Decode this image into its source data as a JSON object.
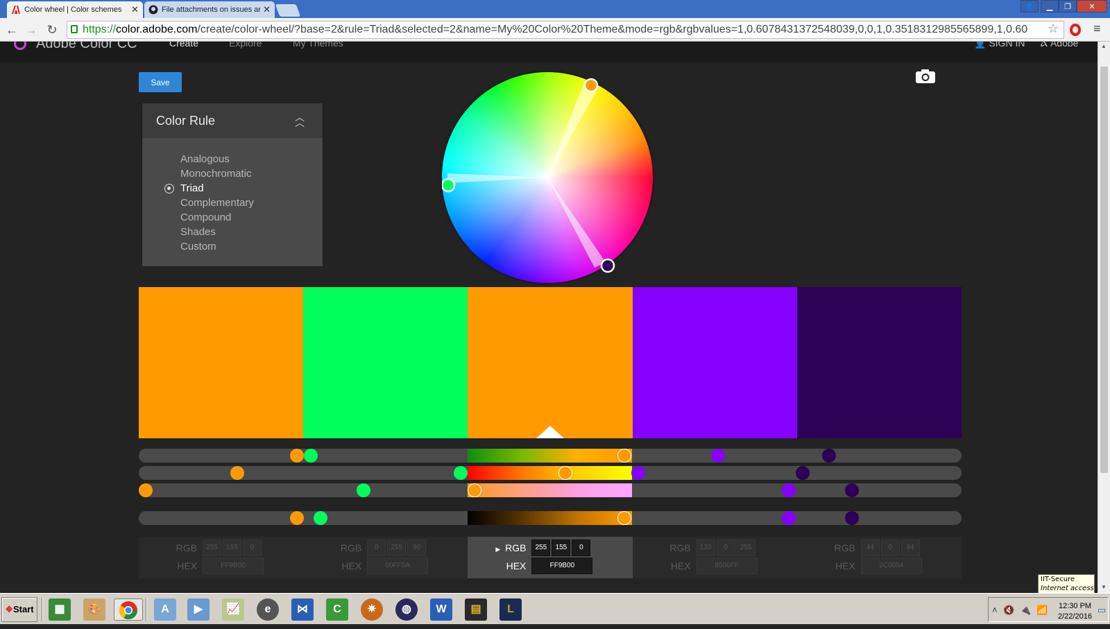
{
  "browser": {
    "tabs": [
      {
        "title": "Color wheel | Color schemes",
        "active": true
      },
      {
        "title": "File attachments on issues ar",
        "active": false
      }
    ],
    "url_scheme": "https://",
    "url_host": "color.adobe.com",
    "url_rest": "/create/color-wheel/?base=2&rule=Triad&selected=2&name=My%20Color%20Theme&mode=rgb&rgbvalues=1,0.6078431372548039,0,0,1,0.3518312985565899,1,0.60"
  },
  "app": {
    "logo_text": "Adobe Color CC",
    "nav": [
      {
        "label": "Create",
        "active": true
      },
      {
        "label": "Explore",
        "active": false
      },
      {
        "label": "My Themes",
        "active": false
      }
    ],
    "sign_in": "SIGN IN",
    "adobe": "Adobe"
  },
  "save_label": "Save",
  "color_rule": {
    "title": "Color Rule",
    "options": [
      "Analogous",
      "Monochromatic",
      "Triad",
      "Complementary",
      "Compound",
      "Shades",
      "Custom"
    ],
    "selected": "Triad"
  },
  "swatches": [
    {
      "hex": "FF9B00",
      "rgb": [
        "255",
        "155",
        "0"
      ],
      "css": "#ff9b00"
    },
    {
      "hex": "00FF5A",
      "rgb": [
        "0",
        "255",
        "90"
      ],
      "css": "#00ff5a"
    },
    {
      "hex": "FF9B00",
      "rgb": [
        "255",
        "155",
        "0"
      ],
      "css": "#ff9b00"
    },
    {
      "hex": "8500FF",
      "rgb": [
        "133",
        "0",
        "255"
      ],
      "css": "#8500ff"
    },
    {
      "hex": "2C0054",
      "rgb": [
        "44",
        "0",
        "84"
      ],
      "css": "#2c0054"
    }
  ],
  "selected_swatch": 3,
  "labels": {
    "rgb": "RGB",
    "hex": "HEX"
  },
  "wifi_tooltip": {
    "name": "IIT-Secure",
    "status": "Internet access"
  },
  "taskbar": {
    "start_label": "Start",
    "time": "12:30 PM",
    "date": "2/22/2016"
  }
}
